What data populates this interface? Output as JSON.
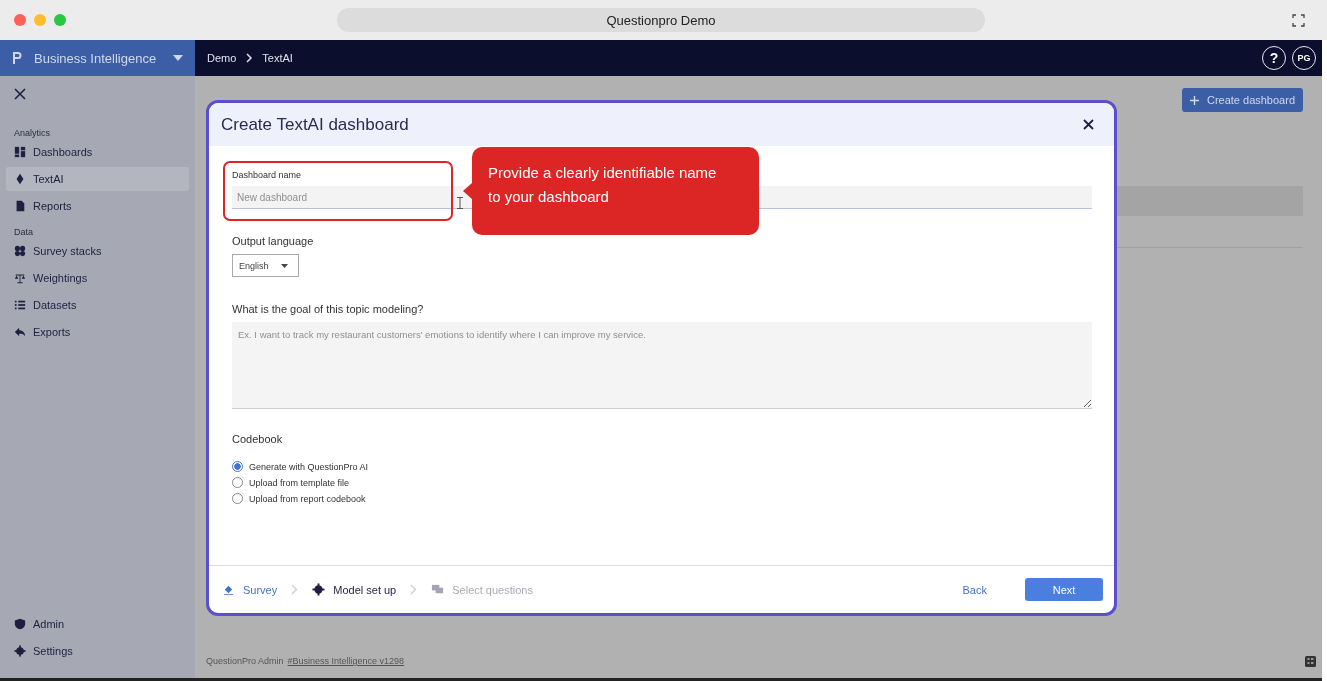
{
  "browser": {
    "title": "Questionpro Demo"
  },
  "app": {
    "product": "Business Intelligence",
    "breadcrumb": [
      "Demo",
      "TextAI"
    ],
    "help": "?",
    "avatar": "PG"
  },
  "sidebar": {
    "sections": [
      {
        "title": "Analytics",
        "items": [
          {
            "label": "Dashboards",
            "selected": false
          },
          {
            "label": "TextAI",
            "selected": true
          },
          {
            "label": "Reports",
            "selected": false
          }
        ]
      },
      {
        "title": "Data",
        "items": [
          {
            "label": "Survey stacks",
            "selected": false
          },
          {
            "label": "Weightings",
            "selected": false
          },
          {
            "label": "Datasets",
            "selected": false
          },
          {
            "label": "Exports",
            "selected": false
          }
        ]
      }
    ],
    "bottom_items": [
      {
        "label": "Admin",
        "selected": false
      },
      {
        "label": "Settings",
        "selected": false
      }
    ]
  },
  "page": {
    "create_button": "Create dashboard",
    "footer_text": "QuestionPro Admin",
    "footer_link": "#Business Intelligence v1298"
  },
  "dialog": {
    "title": "Create TextAI dashboard",
    "name_field": {
      "label": "Dashboard name",
      "placeholder": "New dashboard"
    },
    "language": {
      "label": "Output language",
      "value": "English"
    },
    "goal": {
      "label": "What is the goal of this topic modeling?",
      "placeholder": "Ex. I want to track my restaurant customers' emotions to identify where I can improve my service."
    },
    "codebook": {
      "label": "Codebook",
      "options": [
        {
          "label": "Generate with QuestionPro AI",
          "selected": true
        },
        {
          "label": "Upload from template file",
          "selected": false
        },
        {
          "label": "Upload from report codebook",
          "selected": false
        }
      ]
    },
    "steps": [
      {
        "label": "Survey",
        "completed": true,
        "disabled": false
      },
      {
        "label": "Model set up",
        "completed": false,
        "disabled": false
      },
      {
        "label": "Select questions",
        "completed": false,
        "disabled": true
      }
    ],
    "buttons": {
      "back": "Back",
      "next": "Next"
    }
  },
  "tooltip": {
    "text": "Provide a clearly identifiable name to your dashboard"
  }
}
